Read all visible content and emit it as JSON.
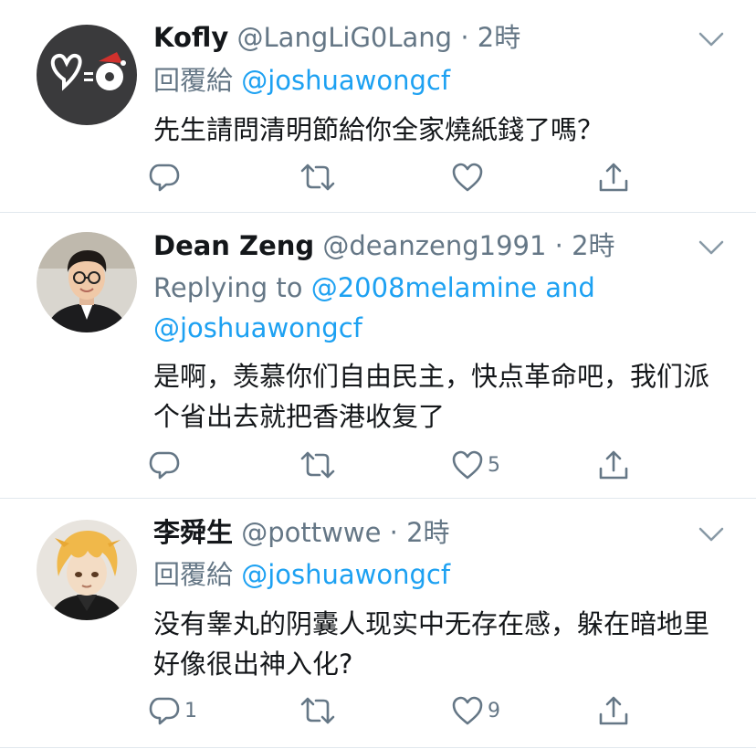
{
  "tweets": [
    {
      "name": "Kofly",
      "handle": "@LangLiG0Lang",
      "time": "2時",
      "reply_prefix": "回覆給",
      "reply_mention": "@joshuawongcf",
      "reply_mention_2": "",
      "reply_line2": "",
      "text": "先生請問清明節給你全家燒紙錢了嗎？",
      "reply_count": "",
      "retweet_count": "",
      "like_count": ""
    },
    {
      "name": "Dean Zeng",
      "handle": "@deanzeng1991",
      "time": "2時",
      "reply_prefix": "Replying to",
      "reply_mention": "@2008melamine and",
      "reply_line2": "@joshuawongcf",
      "text": "是啊，羡慕你们自由民主，快点革命吧，我们派个省出去就把香港收复了",
      "reply_count": "",
      "retweet_count": "",
      "like_count": "5"
    },
    {
      "name": "李舜生",
      "handle": "@pottwwe",
      "time": "2時",
      "reply_prefix": "回覆給",
      "reply_mention": "@joshuawongcf",
      "reply_line2": "",
      "text": "没有睾丸的阴囊人现实中无存在感，躲在暗地里好像很出神入化?",
      "reply_count": "1",
      "retweet_count": "",
      "like_count": "9"
    }
  ],
  "colors": {
    "accent": "#1da1f2",
    "secondary_text": "#657786",
    "divider": "#e1e8ed"
  },
  "icons": [
    "reply-icon",
    "retweet-icon",
    "like-icon",
    "share-icon",
    "chevron-down-icon"
  ]
}
